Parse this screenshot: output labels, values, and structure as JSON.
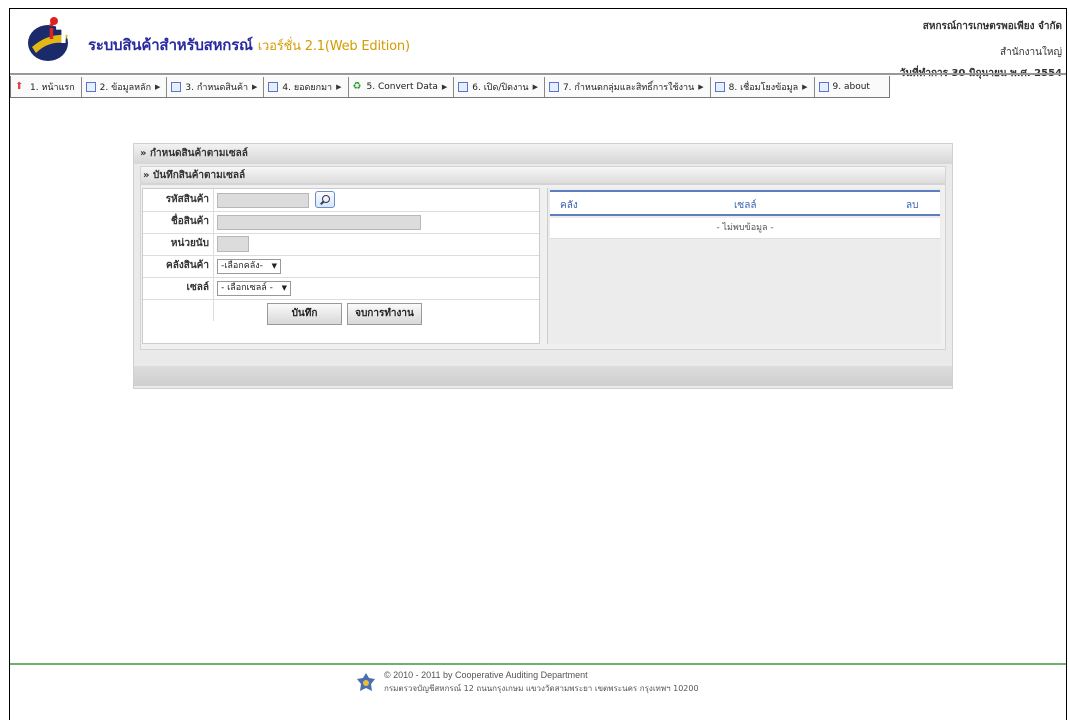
{
  "header": {
    "app_title": "ระบบสินค้าสำหรับสหกรณ์",
    "version": "เวอร์ชั่น 2.1(Web Edition)",
    "org_name": "สหกรณ์การเกษตรพอเพียง จำกัด",
    "branch": "สำนักงานใหญ่",
    "work_date": "วันที่ทำการ 30 มิถุนายน พ.ศ. 2554"
  },
  "menu": [
    {
      "label": "1. หน้าแรก",
      "icon": "home-icon",
      "submenu": false
    },
    {
      "label": "2. ข้อมูลหลัก",
      "icon": "document-icon",
      "submenu": true
    },
    {
      "label": "3. กำหนดสินค้า",
      "icon": "document-icon",
      "submenu": true
    },
    {
      "label": "4. ยอดยกมา",
      "icon": "calendar-icon",
      "submenu": true
    },
    {
      "label": "5. Convert Data",
      "icon": "recycle-icon",
      "submenu": true
    },
    {
      "label": "6. เปิด/ปิดงาน",
      "icon": "document-icon",
      "submenu": true
    },
    {
      "label": "7. กำหนดกลุ่มและสิทธิ์การใช้งาน",
      "icon": "document-icon",
      "submenu": true
    },
    {
      "label": "8. เชื่อมโยงข้อมูล",
      "icon": "document-icon",
      "submenu": true
    },
    {
      "label": "9. about",
      "icon": "document-icon",
      "submenu": false
    }
  ],
  "panel": {
    "title": "» กำหนดสินค้าตามเซลล์",
    "subtitle": "» บันทึกสินค้าตามเซลล์"
  },
  "form": {
    "product_code_label": "รหัสสินค้า",
    "product_name_label": "ชื่อสินค้า",
    "unit_label": "หน่วยนับ",
    "warehouse_label": "คลังสินค้า",
    "warehouse_value": "-เลือกคลัง-",
    "cell_label": "เซลล์",
    "cell_value": "- เลือกเซลล์ -",
    "save_button": "บันทึก",
    "end_button": "จบการทำงาน"
  },
  "grid": {
    "columns": [
      "คลัง",
      "เซลล์",
      "ลบ"
    ],
    "empty_text": "- ไม่พบข้อมูล -"
  },
  "footer": {
    "copyright": "© 2010 - 2011  by Cooperative Auditing Department",
    "address": "กรมตรวจบัญชีสหกรณ์ 12 ถนนกรุงเกษม แขวงวัดสามพระยา เขตพระนคร กรุงเทพฯ 10200"
  }
}
